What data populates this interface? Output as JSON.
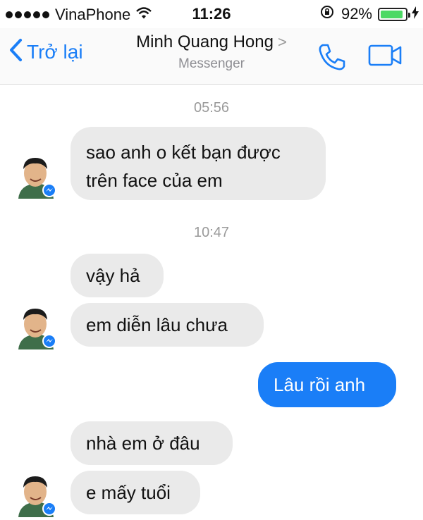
{
  "status_bar": {
    "carrier": "VinaPhone",
    "time": "11:26",
    "battery": "92%",
    "battery_level": 0.92
  },
  "nav": {
    "back_label": "Trở lại",
    "contact_name": "Minh Quang Hong",
    "subtitle": "Messenger",
    "accent_color": "#1a7ef7"
  },
  "conversation": {
    "timestamps": [
      "05:56",
      "10:47"
    ],
    "messages": [
      {
        "sender": "contact",
        "line1": "sao anh o kết bạn được",
        "line2": "trên face của em"
      },
      {
        "sender": "contact",
        "text": "vậy hả"
      },
      {
        "sender": "contact",
        "text": "em diễn lâu chưa"
      },
      {
        "sender": "me",
        "text": "Lâu rồi anh"
      },
      {
        "sender": "contact",
        "text": "nhà em ở đâu"
      },
      {
        "sender": "contact",
        "text": "e mấy tuổi"
      }
    ]
  },
  "icons": [
    "wifi-icon",
    "rotation-lock-icon",
    "battery-icon",
    "charging-icon",
    "back-chevron-icon",
    "chevron-right-icon",
    "phone-icon",
    "video-camera-icon",
    "messenger-badge-icon"
  ]
}
